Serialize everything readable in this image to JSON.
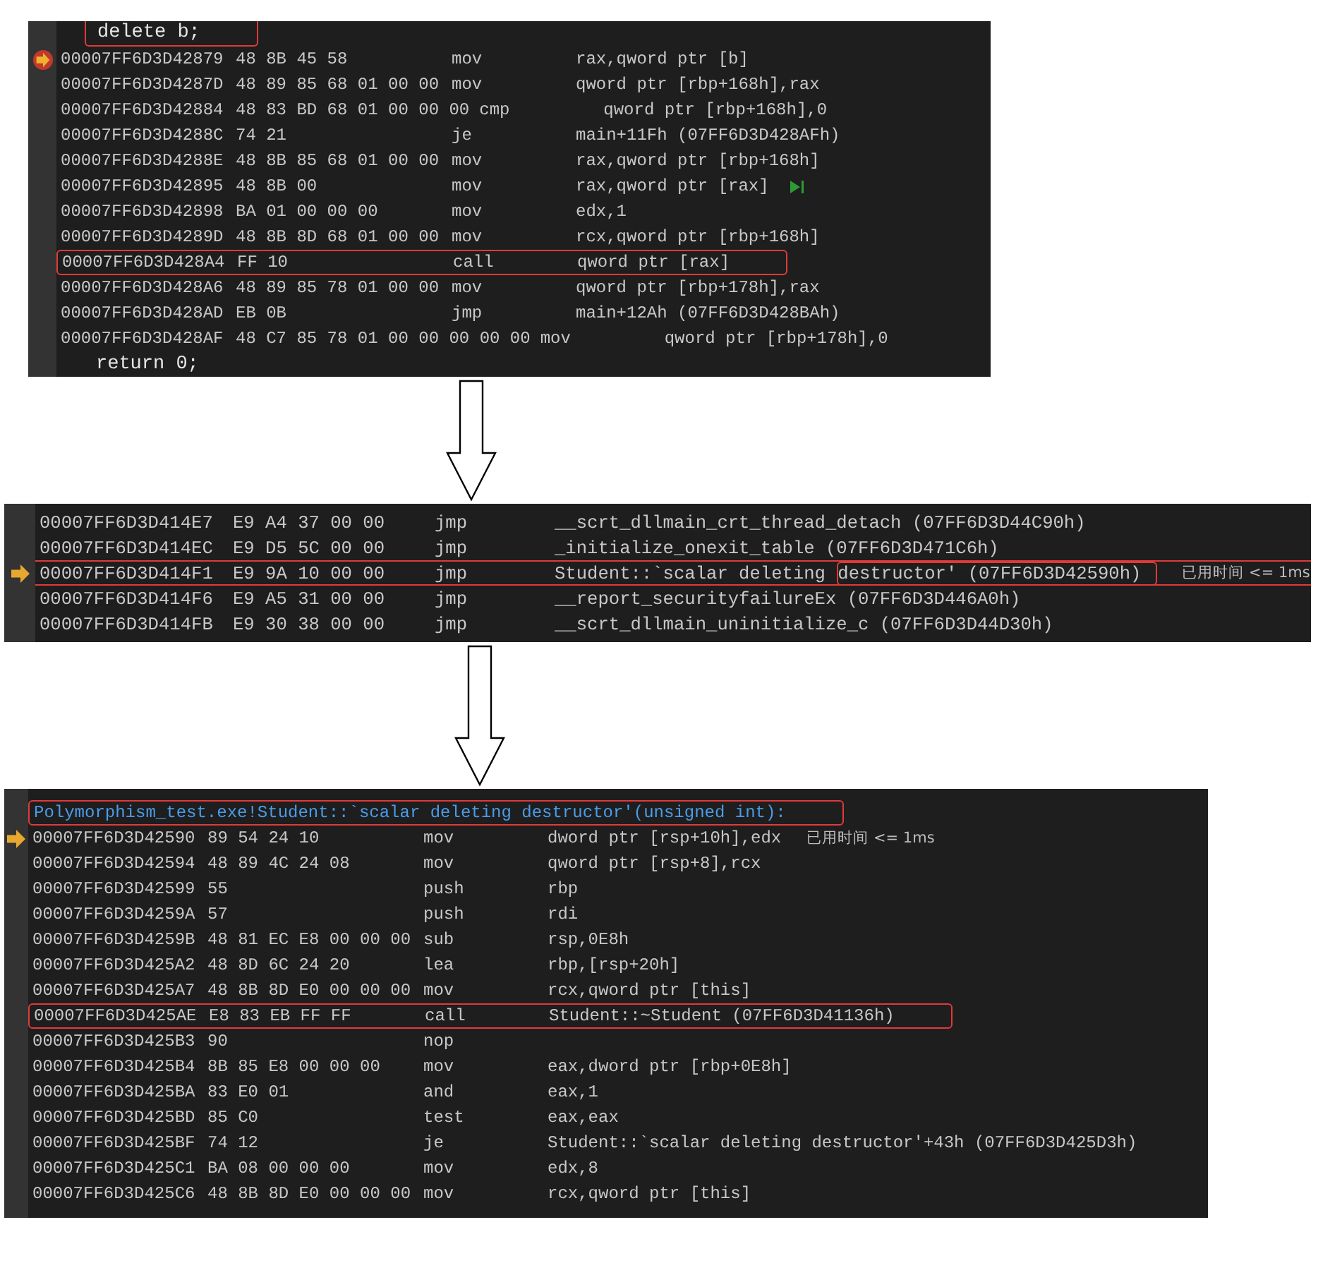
{
  "panels": [
    {
      "kind": "source_view",
      "rows": [
        {
          "kind": "source",
          "text": "delete b;",
          "highlighted": true
        },
        {
          "kind": "instruction",
          "address": "00007FF6D3D42879",
          "bytes": "48 8B 45 58",
          "mnemonic": "mov",
          "operands": "rax,qword ptr [b]",
          "current": true
        },
        {
          "kind": "instruction",
          "address": "00007FF6D3D4287D",
          "bytes": "48 89 85 68 01 00 00",
          "mnemonic": "mov",
          "operands": "qword ptr [rbp+168h],rax"
        },
        {
          "kind": "instruction",
          "address": "00007FF6D3D42884",
          "bytes": "48 83 BD 68 01 00 00 00",
          "mnemonic": "cmp",
          "operands": "qword ptr [rbp+168h],0"
        },
        {
          "kind": "instruction",
          "address": "00007FF6D3D4288C",
          "bytes": "74 21",
          "mnemonic": "je",
          "operands": "main+11Fh (07FF6D3D428AFh)"
        },
        {
          "kind": "instruction",
          "address": "00007FF6D3D4288E",
          "bytes": "48 8B 85 68 01 00 00",
          "mnemonic": "mov",
          "operands": "rax,qword ptr [rbp+168h]"
        },
        {
          "kind": "instruction",
          "address": "00007FF6D3D42895",
          "bytes": "48 8B 00",
          "mnemonic": "mov",
          "operands": "rax,qword ptr [rax]",
          "run_to_cursor": true
        },
        {
          "kind": "instruction",
          "address": "00007FF6D3D42898",
          "bytes": "BA 01 00 00 00",
          "mnemonic": "mov",
          "operands": "edx,1"
        },
        {
          "kind": "instruction",
          "address": "00007FF6D3D4289D",
          "bytes": "48 8B 8D 68 01 00 00",
          "mnemonic": "mov",
          "operands": "rcx,qword ptr [rbp+168h]"
        },
        {
          "kind": "instruction",
          "address": "00007FF6D3D428A4",
          "bytes": "FF 10",
          "mnemonic": "call",
          "operands": "qword ptr [rax]",
          "highlighted": true
        },
        {
          "kind": "instruction",
          "address": "00007FF6D3D428A6",
          "bytes": "48 89 85 78 01 00 00",
          "mnemonic": "mov",
          "operands": "qword ptr [rbp+178h],rax"
        },
        {
          "kind": "instruction",
          "address": "00007FF6D3D428AD",
          "bytes": "EB 0B",
          "mnemonic": "jmp",
          "operands": "main+12Ah (07FF6D3D428BAh)"
        },
        {
          "kind": "instruction",
          "address": "00007FF6D3D428AF",
          "bytes": "48 C7 85 78 01 00 00 00 00 00",
          "mnemonic": "mov",
          "operands": "qword ptr [rbp+178h],0"
        },
        {
          "kind": "source",
          "text": "return 0;"
        }
      ]
    },
    {
      "kind": "disassembly",
      "rows": [
        {
          "kind": "instruction",
          "address": "00007FF6D3D414E7",
          "bytes": "E9 A4 37 00 00",
          "mnemonic": "jmp",
          "operands": "__scrt_dllmain_crt_thread_detach (07FF6D3D44C90h)"
        },
        {
          "kind": "instruction",
          "address": "00007FF6D3D414EC",
          "bytes": "E9 D5 5C 00 00",
          "mnemonic": "jmp",
          "operands": "_initialize_onexit_table (07FF6D3D471C6h)"
        },
        {
          "kind": "instruction",
          "address": "00007FF6D3D414F1",
          "bytes": "E9 9A 10 00 00",
          "mnemonic": "jmp",
          "operands": "Student::`scalar deleting ",
          "operands_boxed": "destructor' (07FF6D3D42590h)",
          "current": true,
          "highlighted": true,
          "full_width": true,
          "note": "已用时间 <= 1ms"
        },
        {
          "kind": "instruction",
          "address": "00007FF6D3D414F6",
          "bytes": "E9 A5 31 00 00",
          "mnemonic": "jmp",
          "operands": "__report_securityfailureEx (07FF6D3D446A0h)"
        },
        {
          "kind": "instruction",
          "address": "00007FF6D3D414FB",
          "bytes": "E9 30 38 00 00",
          "mnemonic": "jmp",
          "operands": "__scrt_dllmain_uninitialize_c (07FF6D3D44D30h)"
        }
      ]
    },
    {
      "kind": "disassembly",
      "rows": [
        {
          "kind": "label",
          "text": "Polymorphism_test.exe!Student::`scalar deleting destructor'(unsigned int):",
          "highlighted": true
        },
        {
          "kind": "instruction",
          "address": "00007FF6D3D42590",
          "bytes": "89 54 24 10",
          "mnemonic": "mov",
          "operands": "dword ptr [rsp+10h],edx",
          "current": true,
          "note": "已用时间 <= 1ms"
        },
        {
          "kind": "instruction",
          "address": "00007FF6D3D42594",
          "bytes": "48 89 4C 24 08",
          "mnemonic": "mov",
          "operands": "qword ptr [rsp+8],rcx"
        },
        {
          "kind": "instruction",
          "address": "00007FF6D3D42599",
          "bytes": "55",
          "mnemonic": "push",
          "operands": "rbp"
        },
        {
          "kind": "instruction",
          "address": "00007FF6D3D4259A",
          "bytes": "57",
          "mnemonic": "push",
          "operands": "rdi"
        },
        {
          "kind": "instruction",
          "address": "00007FF6D3D4259B",
          "bytes": "48 81 EC E8 00 00 00",
          "mnemonic": "sub",
          "operands": "rsp,0E8h"
        },
        {
          "kind": "instruction",
          "address": "00007FF6D3D425A2",
          "bytes": "48 8D 6C 24 20",
          "mnemonic": "lea",
          "operands": "rbp,[rsp+20h]"
        },
        {
          "kind": "instruction",
          "address": "00007FF6D3D425A7",
          "bytes": "48 8B 8D E0 00 00 00",
          "mnemonic": "mov",
          "operands": "rcx,qword ptr [this]"
        },
        {
          "kind": "instruction",
          "address": "00007FF6D3D425AE",
          "bytes": "E8 83 EB FF FF",
          "mnemonic": "call",
          "operands": "Student::~Student (07FF6D3D41136h)",
          "highlighted": true
        },
        {
          "kind": "instruction",
          "address": "00007FF6D3D425B3",
          "bytes": "90",
          "mnemonic": "nop"
        },
        {
          "kind": "instruction",
          "address": "00007FF6D3D425B4",
          "bytes": "8B 85 E8 00 00 00",
          "mnemonic": "mov",
          "operands": "eax,dword ptr [rbp+0E8h]"
        },
        {
          "kind": "instruction",
          "address": "00007FF6D3D425BA",
          "bytes": "83 E0 01",
          "mnemonic": "and",
          "operands": "eax,1"
        },
        {
          "kind": "instruction",
          "address": "00007FF6D3D425BD",
          "bytes": "85 C0",
          "mnemonic": "test",
          "operands": "eax,eax"
        },
        {
          "kind": "instruction",
          "address": "00007FF6D3D425BF",
          "bytes": "74 12",
          "mnemonic": "je",
          "operands": "Student::`scalar deleting destructor'+43h (07FF6D3D425D3h)"
        },
        {
          "kind": "instruction",
          "address": "00007FF6D3D425C1",
          "bytes": "BA 08 00 00 00",
          "mnemonic": "mov",
          "operands": "edx,8"
        },
        {
          "kind": "instruction",
          "address": "00007FF6D3D425C6",
          "bytes": "48 8B 8D E0 00 00 00",
          "mnemonic": "mov",
          "operands": "rcx,qword ptr [this]"
        }
      ]
    }
  ]
}
